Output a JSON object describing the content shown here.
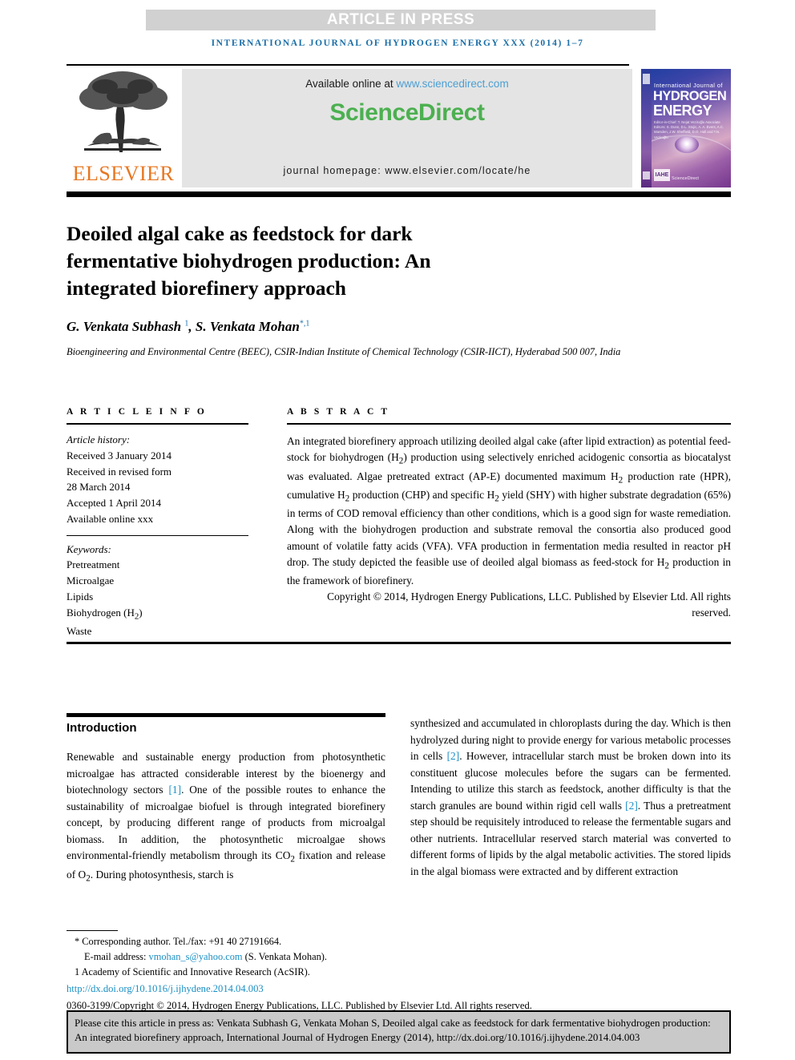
{
  "banner": {
    "article_in_press": "ARTICLE IN PRESS",
    "running_head": "INTERNATIONAL JOURNAL OF HYDROGEN ENERGY XXX (2014) 1–7"
  },
  "masthead": {
    "publisher": "ELSEVIER",
    "available_online_prefix": "Available online at ",
    "available_online_link": "www.sciencedirect.com",
    "sciencedirect_logo_a": "Science",
    "sciencedirect_logo_b": "Direct",
    "journal_homepage": "journal homepage: www.elsevier.com/locate/he",
    "cover": {
      "line_small": "International Journal of",
      "line_big_1": "HYDROGEN",
      "line_big_2": "ENERGY",
      "editors": "Editor-in-Chief: T. Nejat Veziroğlu\nAssociate Editors: S. Dunn, D.L. Stojic, A. A. Evers, A.C. Marsden, J.W. Sheffield, D.O. Hall and T.N. Veziroğlu",
      "badge": "IAHE",
      "sciencedirect": "ScienceDirect"
    }
  },
  "article": {
    "title": "Deoiled algal cake as feedstock for dark fermentative biohydrogen production: An integrated biorefinery approach",
    "authors_html": "G. Venkata Subhash <sup>1</sup>, S. Venkata Mohan<sup>*,1</sup>",
    "affiliation": "Bioengineering and Environmental Centre (BEEC), CSIR-Indian Institute of Chemical Technology (CSIR-IICT), Hyderabad 500 007, India"
  },
  "article_info": {
    "heading": "A R T I C L E   I N F O",
    "history_label": "Article history:",
    "history": [
      "Received 3 January 2014",
      "Received in revised form",
      "28 March 2014",
      "Accepted 1 April 2014",
      "Available online xxx"
    ],
    "keywords_label": "Keywords:",
    "keywords_html": "Pretreatment<br>Microalgae<br>Lipids<br>Biohydrogen (H<sub>2</sub>)<br>Waste"
  },
  "abstract": {
    "heading": "A B S T R A C T",
    "body_html": "An integrated biorefinery approach utilizing deoiled algal cake (after lipid extraction) as potential feed-stock for biohydrogen (H<sub>2</sub>) production using selectively enriched acidogenic consortia as biocatalyst was evaluated. Algae pretreated extract (AP-E) documented maximum H<sub>2</sub> production rate (HPR), cumulative H<sub>2</sub> production (CHP) and specific H<sub>2</sub> yield (SHY) with higher substrate degradation (65%) in terms of COD removal efficiency than other conditions, which is a good sign for waste remediation. Along with the biohydrogen production and substrate removal the consortia also produced good amount of volatile fatty acids (VFA). VFA production in fermentation media resulted in reactor pH drop. The study depicted the feasible use of deoiled algal biomass as feed-stock for H<sub>2</sub> production in the framework of biorefinery.",
    "copyright": "Copyright © 2014, Hydrogen Energy Publications, LLC. Published by Elsevier Ltd. All rights reserved."
  },
  "introduction": {
    "heading": "Introduction",
    "left_html": "Renewable and sustainable energy production from photosynthetic microalgae has attracted considerable interest by the bioenergy and biotechnology sectors <span class=\"ref\">[1]</span>. One of the possible routes to enhance the sustainability of microalgae biofuel is through integrated biorefinery concept, by producing different range of products from microalgal biomass. In addition, the photosynthetic microalgae shows environmental-friendly metabolism through its CO<sub>2</sub> fixation and release of O<sub>2</sub>. During photosynthesis, starch is",
    "right_html": "synthesized and accumulated in chloroplasts during the day. Which is then hydrolyzed during night to provide energy for various metabolic processes in cells <span class=\"ref\">[2]</span>. However, intracellular starch must be broken down into its constituent glucose molecules before the sugars can be fermented. Intending to utilize this starch as feedstock, another difficulty is that the starch granules are bound within rigid cell walls <span class=\"ref\">[2]</span>. Thus a pretreatment step should be requisitely introduced to release the fermentable sugars and other nutrients. Intracellular reserved starch material was converted to different forms of lipids by the algal metabolic activities. The stored lipids in the algal biomass were extracted and by different extraction"
  },
  "footnotes": {
    "corresponding": "* Corresponding author. Tel./fax: +91 40 27191664.",
    "email_label": "E-mail address: ",
    "email_link": "vmohan_s@yahoo.com",
    "email_suffix": " (S. Venkata Mohan).",
    "academy": "1 Academy of Scientific and Innovative Research (AcSIR).",
    "doi": "http://dx.doi.org/10.1016/j.ijhydene.2014.04.003",
    "issn": "0360-3199/Copyright © 2014, Hydrogen Energy Publications, LLC. Published by Elsevier Ltd. All rights reserved."
  },
  "cite_box": {
    "text": "Please cite this article in press as: Venkata Subhash G, Venkata Mohan S, Deoiled algal cake as feedstock for dark fermentative biohydrogen production: An integrated biorefinery approach, International Journal of Hydrogen Energy (2014), http://dx.doi.org/10.1016/j.ijhydene.2014.04.003"
  },
  "colors": {
    "banner_gray": "#d1d1d1",
    "running_head_blue": "#1a6ea8",
    "elsevier_orange": "#e87722",
    "sciencedirect_green": "#4caf50",
    "link_blue": "#1a8fc4",
    "cite_box_gray": "#c9c9c9"
  }
}
